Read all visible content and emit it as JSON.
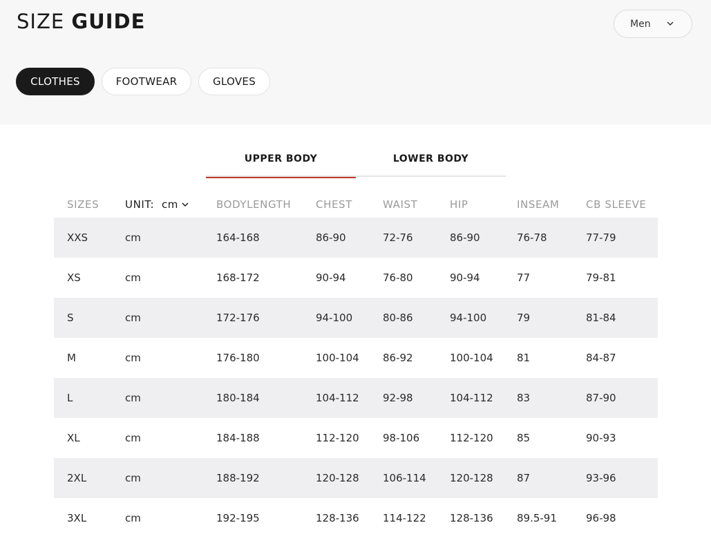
{
  "header": {
    "title_light": "SIZE",
    "title_bold": "GUIDE",
    "gender_select": {
      "value": "Men",
      "icon": "chevron-down-icon"
    }
  },
  "category_tabs": [
    {
      "label": "CLOTHES",
      "active": true
    },
    {
      "label": "FOOTWEAR",
      "active": false
    },
    {
      "label": "GLOVES",
      "active": false
    }
  ],
  "section_tabs": [
    {
      "label": "UPPER BODY",
      "active": true
    },
    {
      "label": "LOWER BODY",
      "active": false
    }
  ],
  "accent_color": "#c0392b",
  "table": {
    "headers": {
      "sizes": "SIZES",
      "unit_label": "UNIT:",
      "unit_value": "cm",
      "bodylength": "BODYLENGTH",
      "chest": "CHEST",
      "waist": "WAIST",
      "hip": "HIP",
      "inseam": "INSEAM",
      "cb_sleeve": "CB SLEEVE"
    },
    "rows": [
      [
        "XXS",
        "cm",
        "164-168",
        "86-90",
        "72-76",
        "86-90",
        "76-78",
        "77-79"
      ],
      [
        "XS",
        "cm",
        "168-172",
        "90-94",
        "76-80",
        "90-94",
        "77",
        "79-81"
      ],
      [
        "S",
        "cm",
        "172-176",
        "94-100",
        "80-86",
        "94-100",
        "79",
        "81-84"
      ],
      [
        "M",
        "cm",
        "176-180",
        "100-104",
        "86-92",
        "100-104",
        "81",
        "84-87"
      ],
      [
        "L",
        "cm",
        "180-184",
        "104-112",
        "92-98",
        "104-112",
        "83",
        "87-90"
      ],
      [
        "XL",
        "cm",
        "184-188",
        "112-120",
        "98-106",
        "112-120",
        "85",
        "90-93"
      ],
      [
        "2XL",
        "cm",
        "188-192",
        "120-128",
        "106-114",
        "120-128",
        "87",
        "93-96"
      ],
      [
        "3XL",
        "cm",
        "192-195",
        "128-136",
        "114-122",
        "128-136",
        "89.5-91",
        "96-98"
      ]
    ]
  }
}
